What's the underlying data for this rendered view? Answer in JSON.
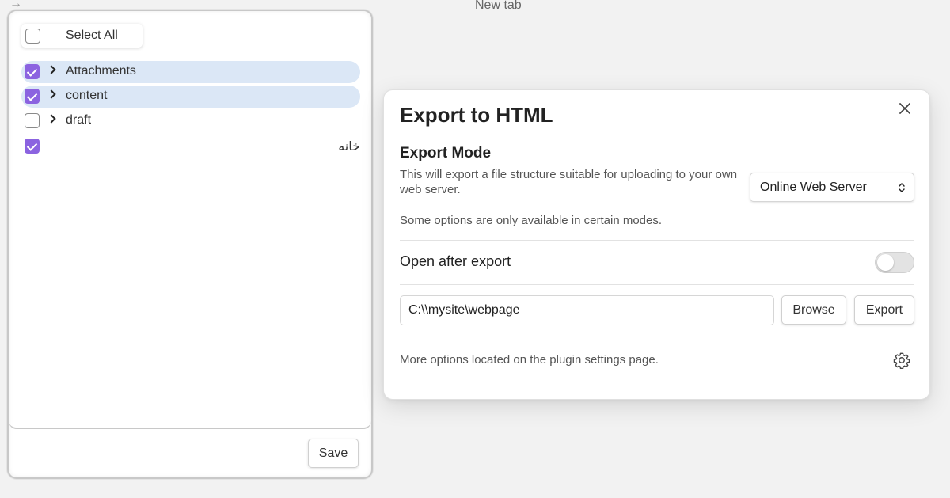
{
  "top": {
    "new_tab_label": "New tab",
    "back_arrow_icon": "arrow-right-icon"
  },
  "file_panel": {
    "select_all_label": "Select All",
    "items": [
      {
        "label": "Attachments",
        "checked": true,
        "selected": true,
        "expandable": true
      },
      {
        "label": "content",
        "checked": true,
        "selected": true,
        "expandable": true
      },
      {
        "label": "draft",
        "checked": false,
        "selected": false,
        "expandable": true
      },
      {
        "label": "خانه",
        "checked": true,
        "selected": false,
        "expandable": false
      }
    ],
    "save_label": "Save"
  },
  "modal": {
    "title": "Export to HTML",
    "mode_heading": "Export Mode",
    "mode_description": "This will export a file structure suitable for uploading to your own web server.",
    "mode_select_value": "Online Web Server",
    "options_note": "Some options are only available in certain modes.",
    "open_after_export_label": "Open after export",
    "open_after_export_on": false,
    "path_value": "C:\\\\mysite\\webpage",
    "browse_label": "Browse",
    "export_label": "Export",
    "more_options_note": "More options located on the plugin settings page."
  },
  "colors": {
    "checkbox_checked": "#8b63e0",
    "row_selected": "#dbe7f6"
  }
}
